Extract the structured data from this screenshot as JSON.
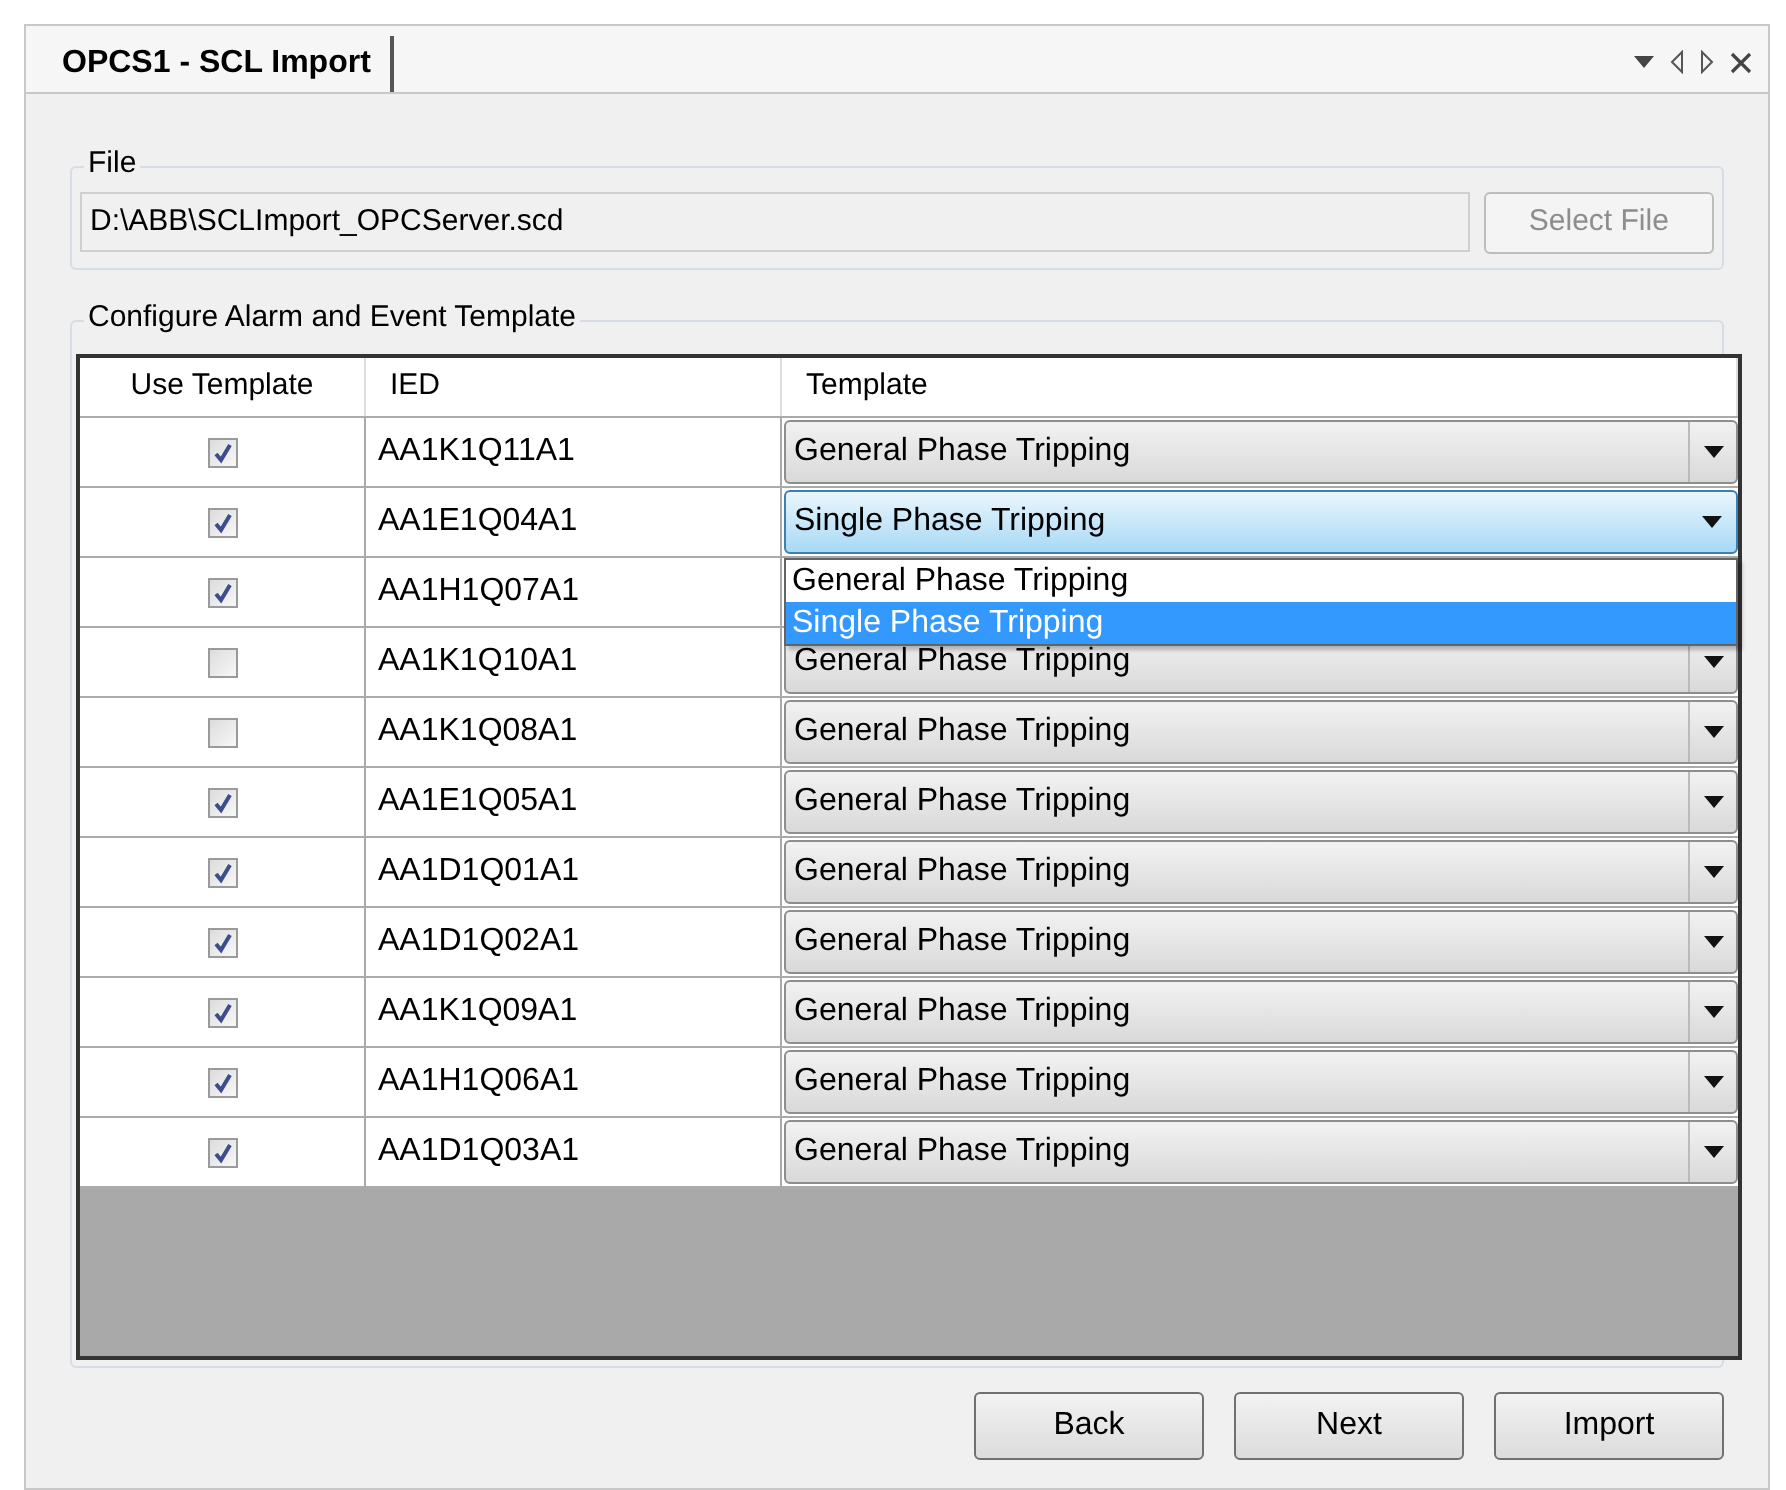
{
  "tab": {
    "label": "OPCS1 - SCL Import",
    "selected": true
  },
  "file_group": {
    "legend": "File",
    "path": "D:\\ABB\\SCLImport_OPCServer.scd",
    "select_button": {
      "label": "Select File",
      "disabled": true
    }
  },
  "template_group": {
    "legend": "Configure Alarm and Event Template",
    "columns": [
      "Use Template",
      "IED",
      "Template"
    ],
    "rows": [
      {
        "use_template": true,
        "ied": "AA1K1Q11A1",
        "template": "General Phase Tripping",
        "expanded": false
      },
      {
        "use_template": true,
        "ied": "AA1E1Q04A1",
        "template": "Single Phase Tripping",
        "expanded": true,
        "options": [
          {
            "label": "General Phase Tripping",
            "selected": false
          },
          {
            "label": "Single Phase Tripping",
            "selected": true
          }
        ]
      },
      {
        "use_template": true,
        "ied": "AA1H1Q07A1"
      },
      {
        "use_template": false,
        "ied": "AA1K1Q10A1",
        "template": "General Phase Tripping",
        "expanded": false
      },
      {
        "use_template": false,
        "ied": "AA1K1Q08A1",
        "template": "General Phase Tripping",
        "expanded": false
      },
      {
        "use_template": true,
        "ied": "AA1E1Q05A1",
        "template": "General Phase Tripping",
        "expanded": false
      },
      {
        "use_template": true,
        "ied": "AA1D1Q01A1",
        "template": "General Phase Tripping",
        "expanded": false
      },
      {
        "use_template": true,
        "ied": "AA1D1Q02A1",
        "template": "General Phase Tripping",
        "expanded": false
      },
      {
        "use_template": true,
        "ied": "AA1K1Q09A1",
        "template": "General Phase Tripping",
        "expanded": false
      },
      {
        "use_template": true,
        "ied": "AA1H1Q06A1",
        "template": "General Phase Tripping",
        "expanded": false
      },
      {
        "use_template": true,
        "ied": "AA1D1Q03A1",
        "template": "General Phase Tripping",
        "expanded": false
      }
    ]
  },
  "buttons": [
    {
      "label": "Back"
    },
    {
      "label": "Next"
    },
    {
      "label": "Import"
    }
  ]
}
